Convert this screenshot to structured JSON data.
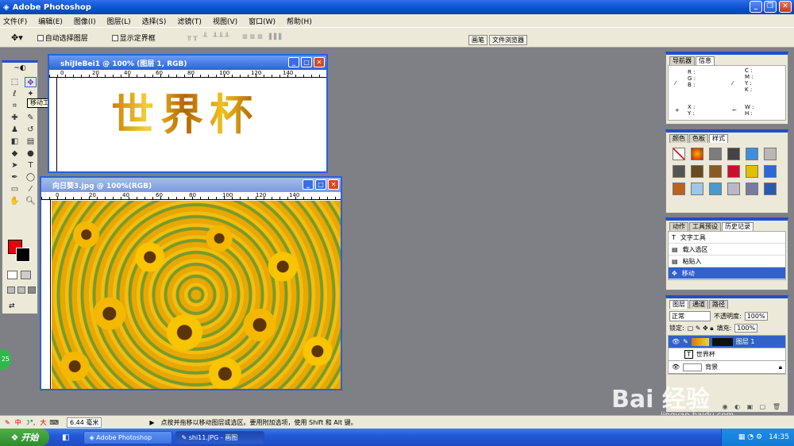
{
  "app": {
    "title": "Adobe Photoshop"
  },
  "menu": [
    "文件(F)",
    "编辑(E)",
    "图像(I)",
    "图层(L)",
    "选择(S)",
    "滤镜(T)",
    "视图(V)",
    "窗口(W)",
    "帮助(H)"
  ],
  "options": {
    "auto_select": "自动选择图层",
    "show_bounds": "显示定界框"
  },
  "right_tabs": [
    "画笔",
    "文件浏览器"
  ],
  "tooltip": "移动工具(V)",
  "doc1": {
    "title": "shiJIeBei1 @ 100% (图层 1, RGB)",
    "text": "世界杯",
    "ruler": [
      "0",
      "20",
      "40",
      "60",
      "80",
      "100",
      "120",
      "140"
    ]
  },
  "doc2": {
    "title": "向日葵3.jpg @ 100%(RGB)",
    "ruler": [
      "0",
      "20",
      "40",
      "60",
      "80",
      "100",
      "120",
      "140"
    ]
  },
  "nav_panel": {
    "tabs": [
      "导航器",
      "信息"
    ],
    "rgb": "R :\nG :\nB :",
    "cmyk": "C :\nM :\nY :\nK :",
    "xy": "X :\nY :",
    "wh": "W :\nH :"
  },
  "style_panel": {
    "tabs": [
      "颜色",
      "色板",
      "样式"
    ]
  },
  "history_panel": {
    "tabs": [
      "动作",
      "工具预设",
      "历史记录"
    ],
    "items": [
      "文字工具",
      "载入选区",
      "粘贴入",
      "移动"
    ]
  },
  "layers_panel": {
    "tabs": [
      "图层",
      "通道",
      "路径"
    ],
    "mode": "正常",
    "opacity_label": "不透明度:",
    "opacity": "100%",
    "lock_label": "锁定:",
    "fill_label": "填充:",
    "fill": "100%",
    "layers": [
      "图层 1",
      "世界杯",
      "背景"
    ]
  },
  "status": {
    "zoom": "6.44 毫米",
    "hint": "点按并拖移以移动图层或选区。要用附加选项，使用 Shift 和 Alt 键。"
  },
  "taskbar": {
    "start": "开始",
    "items": [
      "Adobe Photoshop",
      "shi11.JPG - 画图"
    ],
    "clock": "14:35"
  },
  "watermark": {
    "brand": "Bai 经验",
    "url": "jingyan.baidu.com"
  },
  "green_badge": "25",
  "ime": "中",
  "ime_big": "大"
}
